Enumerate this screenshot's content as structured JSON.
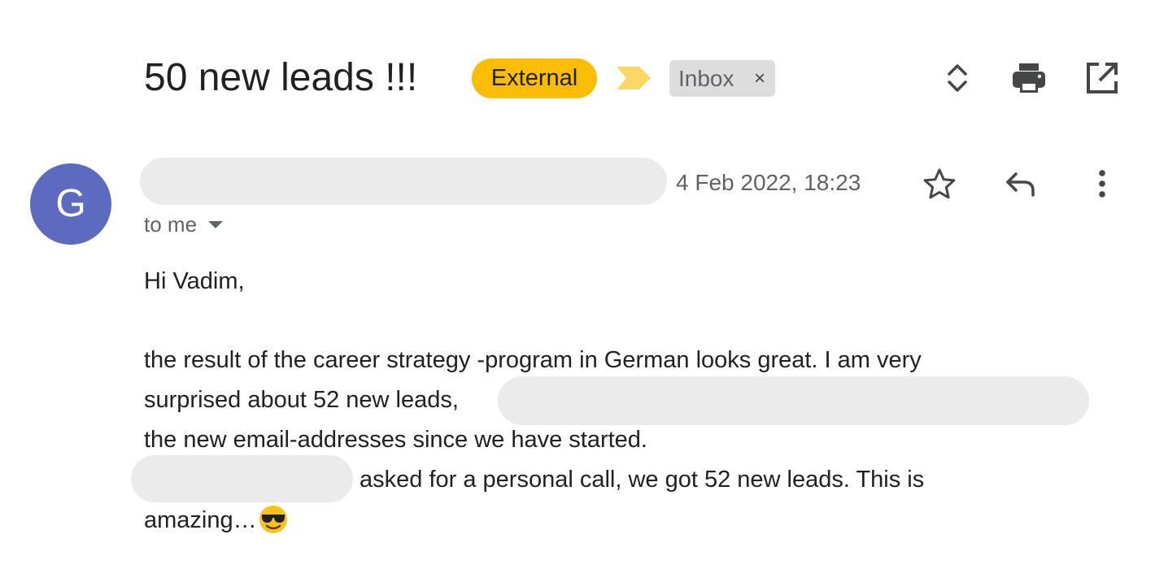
{
  "subject": {
    "title": "50 new leads !!!",
    "labels": {
      "external": "External",
      "inbox": "Inbox",
      "remove_symbol": "×"
    }
  },
  "toolbar_icons": [
    "expand-collapse-icon",
    "print-icon",
    "open-in-new-window-icon"
  ],
  "message": {
    "avatar_initial": "G",
    "avatar_color": "#5c6bc0",
    "date": "4 Feb 2022, 18:23",
    "recipient": "to me",
    "action_icons": [
      "star-icon",
      "reply-icon",
      "more-vert-icon"
    ]
  },
  "body": {
    "greeting": "Hi Vadim,",
    "line1": "the result of the career strategy -program in German looks great. I am very",
    "line2": "surprised about 52 new leads,",
    "line3": "the new email-addresses since we have started.",
    "line4": "asked for a personal call,  we got 52 new leads. This is",
    "line5": "amazing…",
    "emoji": "smiling-face-with-sunglasses"
  },
  "colors": {
    "external_chip": "#fbbc04",
    "importance_marker": "#fdd663",
    "inbox_chip": "#dddddd",
    "redaction": "#ebebeb"
  }
}
